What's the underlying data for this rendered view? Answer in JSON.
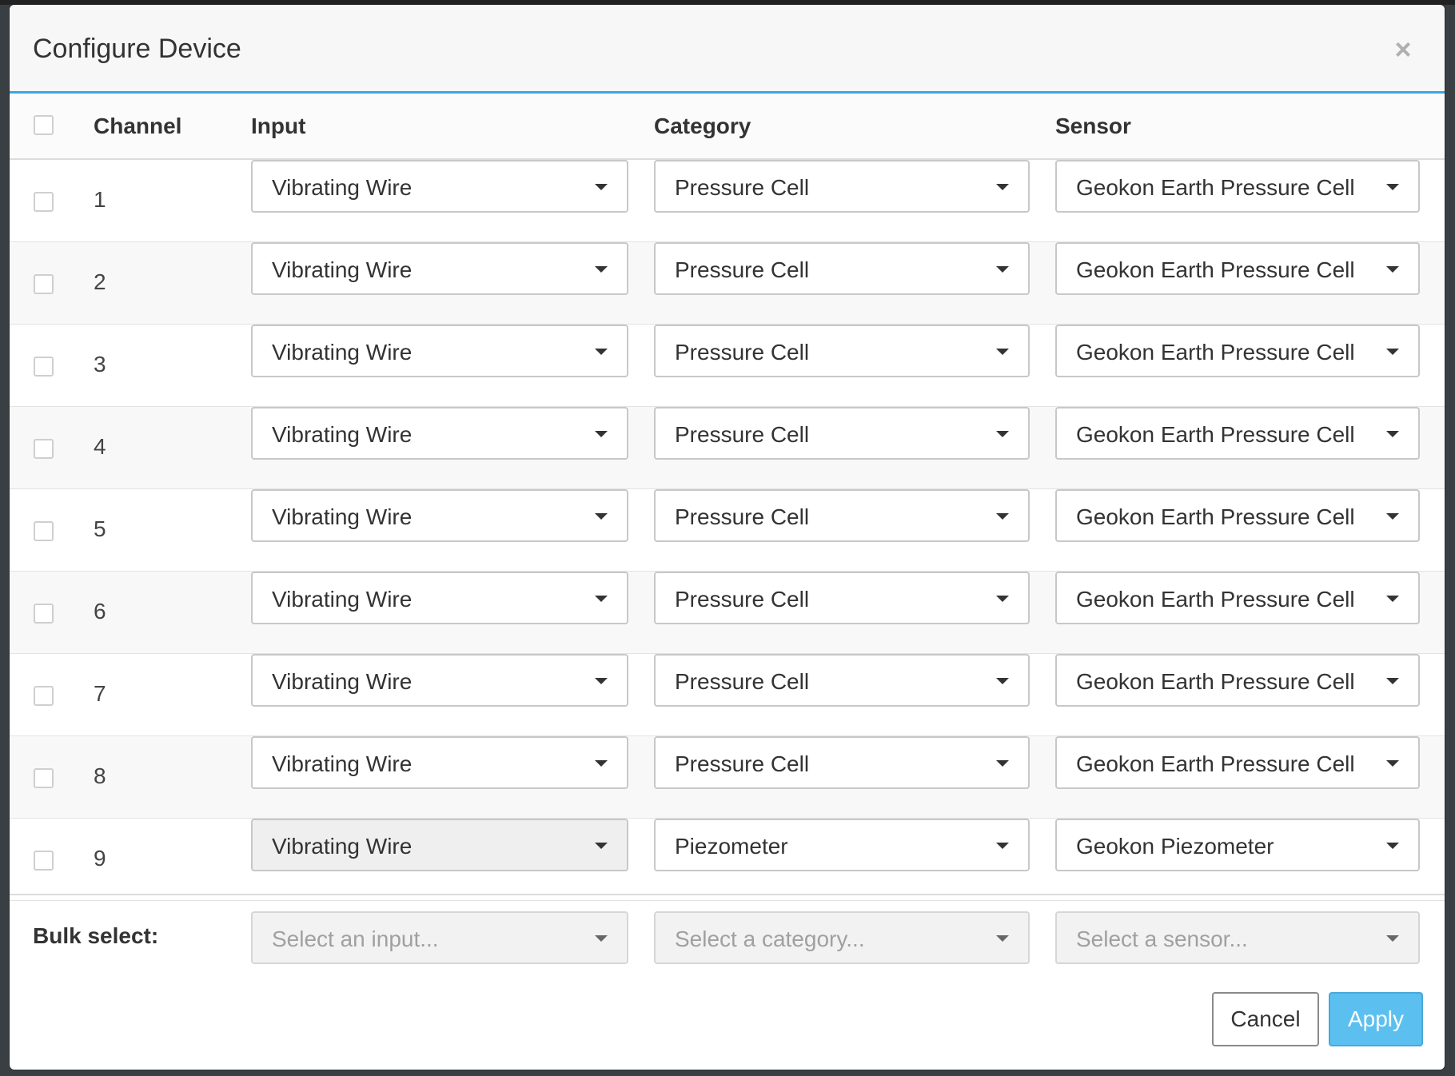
{
  "dialog": {
    "title": "Configure Device",
    "close_glyph": "×"
  },
  "table": {
    "headers": {
      "channel": "Channel",
      "input": "Input",
      "category": "Category",
      "sensor": "Sensor"
    },
    "rows": [
      {
        "channel": "1",
        "input": "Vibrating Wire",
        "category": "Pressure Cell",
        "sensor": "Geokon Earth Pressure Cell"
      },
      {
        "channel": "2",
        "input": "Vibrating Wire",
        "category": "Pressure Cell",
        "sensor": "Geokon Earth Pressure Cell"
      },
      {
        "channel": "3",
        "input": "Vibrating Wire",
        "category": "Pressure Cell",
        "sensor": "Geokon Earth Pressure Cell"
      },
      {
        "channel": "4",
        "input": "Vibrating Wire",
        "category": "Pressure Cell",
        "sensor": "Geokon Earth Pressure Cell"
      },
      {
        "channel": "5",
        "input": "Vibrating Wire",
        "category": "Pressure Cell",
        "sensor": "Geokon Earth Pressure Cell"
      },
      {
        "channel": "6",
        "input": "Vibrating Wire",
        "category": "Pressure Cell",
        "sensor": "Geokon Earth Pressure Cell"
      },
      {
        "channel": "7",
        "input": "Vibrating Wire",
        "category": "Pressure Cell",
        "sensor": "Geokon Earth Pressure Cell"
      },
      {
        "channel": "8",
        "input": "Vibrating Wire",
        "category": "Pressure Cell",
        "sensor": "Geokon Earth Pressure Cell"
      },
      {
        "channel": "9",
        "input": "Vibrating Wire",
        "category": "Piezometer",
        "sensor": "Geokon Piezometer"
      }
    ]
  },
  "bulk": {
    "label": "Bulk select:",
    "input_placeholder": "Select an input...",
    "category_placeholder": "Select a category...",
    "sensor_placeholder": "Select a sensor..."
  },
  "footer": {
    "cancel_label": "Cancel",
    "apply_label": "Apply"
  },
  "colors": {
    "accent": "#3aa7e0",
    "apply_button": "#5bc0f0"
  },
  "icons": {
    "close": "close-icon",
    "dropdown": "chevron-down-icon"
  }
}
